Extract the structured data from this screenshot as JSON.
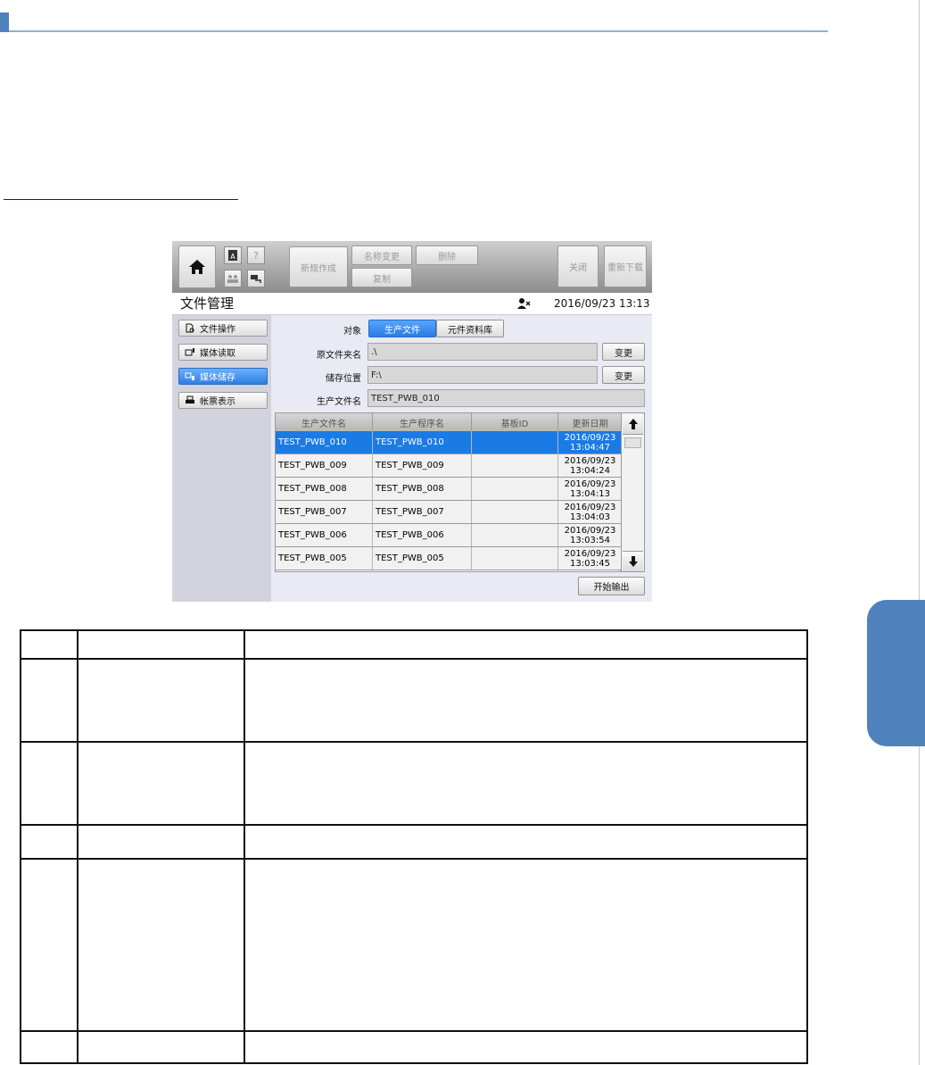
{
  "toolbar": {
    "new_label": "新规作成",
    "rename_label": "名称变更",
    "delete_label": "删除",
    "copy_label": "复制",
    "close_label": "关闭",
    "redownload_label": "重新下载"
  },
  "header": {
    "title": "文件管理",
    "datetime": "2016/09/23 13:13"
  },
  "nav": {
    "items": [
      {
        "label": "文件操作"
      },
      {
        "label": "媒体读取"
      },
      {
        "label": "媒体储存"
      },
      {
        "label": "帐票表示"
      }
    ]
  },
  "form": {
    "target_label": "对象",
    "target_production": "生产文件",
    "target_library": "元件资料库",
    "source_folder_label": "原文件夹名",
    "source_folder_value": ".\\",
    "save_location_label": "储存位置",
    "save_location_value": "F:\\",
    "production_file_label": "生产文件名",
    "production_file_value": "TEST_PWB_010",
    "change_label": "变更"
  },
  "table": {
    "headers": [
      "生产文件名",
      "生产程序名",
      "基板ID",
      "更新日期"
    ],
    "rows": [
      {
        "file": "TEST_PWB_010",
        "program": "TEST_PWB_010",
        "board_id": "",
        "date": "2016/09/23",
        "time": "13:04:47"
      },
      {
        "file": "TEST_PWB_009",
        "program": "TEST_PWB_009",
        "board_id": "",
        "date": "2016/09/23",
        "time": "13:04:24"
      },
      {
        "file": "TEST_PWB_008",
        "program": "TEST_PWB_008",
        "board_id": "",
        "date": "2016/09/23",
        "time": "13:04:13"
      },
      {
        "file": "TEST_PWB_007",
        "program": "TEST_PWB_007",
        "board_id": "",
        "date": "2016/09/23",
        "time": "13:04:03"
      },
      {
        "file": "TEST_PWB_006",
        "program": "TEST_PWB_006",
        "board_id": "",
        "date": "2016/09/23",
        "time": "13:03:54"
      },
      {
        "file": "TEST_PWB_005",
        "program": "TEST_PWB_005",
        "board_id": "",
        "date": "2016/09/23",
        "time": "13:03:45"
      }
    ]
  },
  "footer": {
    "start_output_label": "开始输出"
  },
  "colors": {
    "accent": "#4f81bd",
    "selection": "#1a7ae6"
  }
}
